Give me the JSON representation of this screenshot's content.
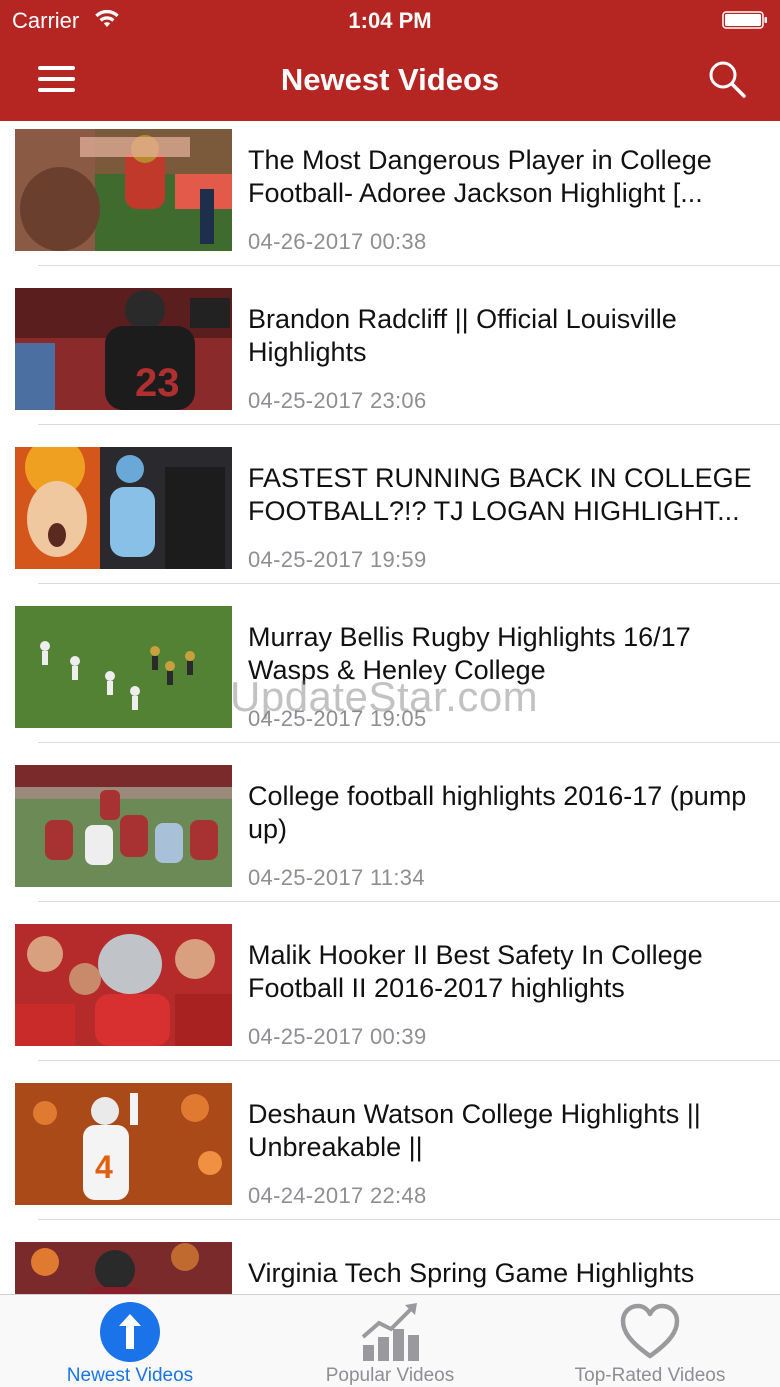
{
  "status_bar": {
    "carrier": "Carrier",
    "time": "1:04 PM"
  },
  "nav": {
    "title": "Newest Videos"
  },
  "videos": [
    {
      "title": "The Most Dangerous Player in College Football- Adoree Jackson Highlight [...",
      "date": "04-26-2017 00:38"
    },
    {
      "title": "Brandon Radcliff || Official Louisville Highlights",
      "date": "04-25-2017 23:06"
    },
    {
      "title": "FASTEST RUNNING BACK IN COLLEGE FOOTBALL?!? TJ LOGAN HIGHLIGHT...",
      "date": "04-25-2017 19:59"
    },
    {
      "title": "Murray Bellis Rugby Highlights 16/17 Wasps & Henley College",
      "date": "04-25-2017 19:05"
    },
    {
      "title": "College football highlights 2016-17 (pump up)",
      "date": "04-25-2017 11:34"
    },
    {
      "title": "Malik Hooker II Best Safety In College Football II 2016-2017 highlights",
      "date": "04-25-2017 00:39"
    },
    {
      "title": "Deshaun Watson College Highlights || Unbreakable ||",
      "date": "04-24-2017 22:48"
    },
    {
      "title": "Virginia Tech Spring Game Highlights",
      "date": ""
    }
  ],
  "watermark": "UpdateStar.com",
  "tabs": [
    {
      "label": "Newest Videos",
      "icon": "upload-arrow-icon",
      "active": true
    },
    {
      "label": "Popular Videos",
      "icon": "bar-chart-trend-icon",
      "active": false
    },
    {
      "label": "Top-Rated Videos",
      "icon": "heart-icon",
      "active": false
    }
  ],
  "colors": {
    "header": "#b52522",
    "tab_active": "#1a73e8",
    "tab_inactive": "#8e8e93",
    "date_text": "#8e8e93"
  }
}
